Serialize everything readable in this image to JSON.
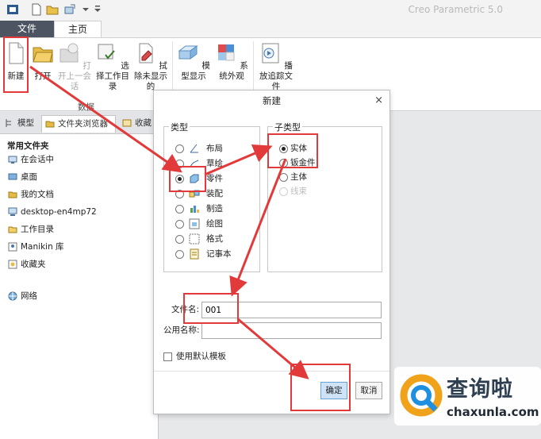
{
  "app": {
    "title": "Creo Parametric 5.0"
  },
  "ribbon": {
    "tabs": [
      {
        "label": "文件"
      },
      {
        "label": "主页"
      }
    ],
    "buttons": [
      {
        "label": "新建",
        "icon": "new-document-icon"
      },
      {
        "label": "打开",
        "icon": "open-folder-icon"
      },
      {
        "label": "打开上一会话",
        "icon": "open-last-session-icon"
      },
      {
        "label": "选择工作目录",
        "icon": "select-working-directory-icon"
      },
      {
        "label": "拭除未显示的",
        "icon": "erase-not-displayed-icon"
      },
      {
        "label": "模型显示",
        "icon": "model-display-icon"
      },
      {
        "label": "系统外观",
        "icon": "system-appearance-icon"
      },
      {
        "label": "播放追踪文件",
        "icon": "play-trail-file-icon"
      }
    ],
    "group_label": "数据"
  },
  "navigator": {
    "tabs": [
      {
        "label": "模型"
      },
      {
        "label": "文件夹浏览器"
      },
      {
        "label": "收藏"
      }
    ],
    "heading": "常用文件夹",
    "items": [
      {
        "label": "在会话中"
      },
      {
        "label": "桌面"
      },
      {
        "label": "我的文档"
      },
      {
        "label": "desktop-en4mp72"
      },
      {
        "label": "工作目录"
      },
      {
        "label": "Manikin 库"
      },
      {
        "label": "收藏夹"
      },
      {
        "label": "网络"
      }
    ]
  },
  "dialog": {
    "title": "新建",
    "type_group_label": "类型",
    "types": [
      {
        "label": "布局",
        "selected": false
      },
      {
        "label": "草绘",
        "selected": false
      },
      {
        "label": "零件",
        "selected": true
      },
      {
        "label": "装配",
        "selected": false
      },
      {
        "label": "制造",
        "selected": false
      },
      {
        "label": "绘图",
        "selected": false
      },
      {
        "label": "格式",
        "selected": false
      },
      {
        "label": "记事本",
        "selected": false
      }
    ],
    "subtype_group_label": "子类型",
    "subtypes": [
      {
        "label": "实体",
        "selected": true,
        "enabled": true
      },
      {
        "label": "钣金件",
        "selected": false,
        "enabled": true
      },
      {
        "label": "主体",
        "selected": false,
        "enabled": true
      },
      {
        "label": "线束",
        "selected": false,
        "enabled": false
      }
    ],
    "filename_label": "文件名:",
    "filename_value": "001",
    "common_name_label": "公用名称:",
    "common_name_value": "",
    "use_default_template_label": "使用默认模板",
    "use_default_template_checked": false,
    "ok_label": "确定",
    "cancel_label": "取消"
  },
  "watermark": {
    "text": "查询啦",
    "url": "chaxunla.com"
  },
  "colors": {
    "annotation": "#e23a3a",
    "file_tab": "#4d5563",
    "primary_button": "#cfe3f7"
  }
}
